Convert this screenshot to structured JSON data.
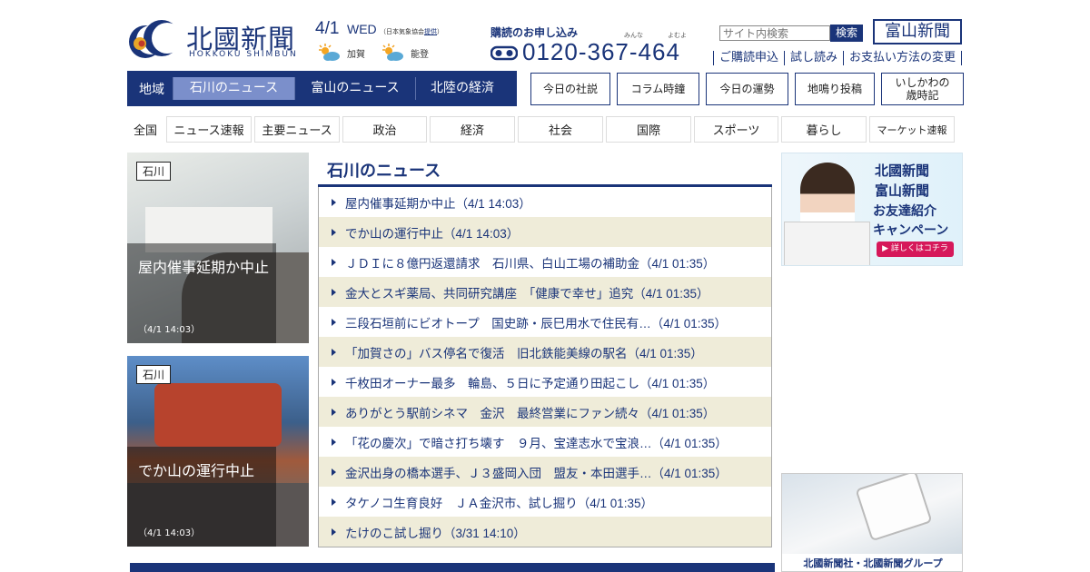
{
  "header": {
    "logo_text": "北國新聞",
    "logo_sub": "HOKKOKU SHIMBUN",
    "date": "4/1",
    "weekday": "WED",
    "weather_note_prefix": "（日本気象協会",
    "weather_note_link": "提供",
    "weather_note_suffix": "）",
    "weather": [
      {
        "area": "加賀",
        "icon": "sun-cloud-icon"
      },
      {
        "area": "能登",
        "icon": "sun-cloud-icon"
      }
    ],
    "subscribe_title": "購読のお申し込み",
    "ruby_1": "みんな",
    "ruby_2": "よむよ",
    "tel": "0120-367-464",
    "search_placeholder": "サイト内検索",
    "search_button": "検索",
    "toyama_button": "富山新聞",
    "links": [
      "ご購読申込",
      "試し読み",
      "お支払い方法の変更"
    ]
  },
  "region_nav": {
    "label": "地域",
    "items": [
      {
        "label": "石川のニュース",
        "active": true
      },
      {
        "label": "富山のニュース",
        "active": false
      },
      {
        "label": "北陸の経済",
        "active": false
      }
    ]
  },
  "column_nav": [
    "今日の社説",
    "コラム時鐘",
    "今日の運勢",
    "地鳴り投稿",
    "いしかわの",
    "歳時記"
  ],
  "category_nav": {
    "first": "全国",
    "items": [
      "ニュース速報",
      "主要ニュース",
      "政治",
      "経済",
      "社会",
      "国際",
      "スポーツ",
      "暮らし",
      "マーケット速報"
    ]
  },
  "cards": [
    {
      "tag": "石川",
      "caption": "屋内催事延期か中止",
      "time": "（4/1 14:03）"
    },
    {
      "tag": "石川",
      "caption": "でか山の運行中止",
      "time": "（4/1 14:03）"
    }
  ],
  "news": {
    "title": "石川のニュース",
    "items": [
      "屋内催事延期か中止（4/1 14:03）",
      "でか山の運行中止（4/1 14:03）",
      "ＪＤＩに８億円返還請求　石川県、白山工場の補助金（4/1 01:35）",
      "金大とスギ薬局、共同研究講座　「健康で幸せ」追究（4/1 01:35）",
      "三段石垣前にビオトープ　国史跡・辰巳用水で住民有…（4/1 01:35）",
      "「加賀さの」バス停名で復活　旧北鉄能美線の駅名（4/1 01:35）",
      "千枚田オーナー最多　輪島、５日に予定通り田起こし（4/1 01:35）",
      "ありがとう駅前シネマ　金沢　最終営業にファン続々（4/1 01:35）",
      "「花の慶次」で暗さ打ち壊す　９月、宝達志水で宝浪…（4/1 01:35）",
      "金沢出身の橋本選手、Ｊ３盛岡入団　盟友・本田選手…（4/1 01:35）",
      "タケノコ生育良好　ＪＡ金沢市、試し掘り（4/1 01:35）",
      "たけのこ試し掘り（3/31 14:10）"
    ]
  },
  "ads": {
    "campaign_line1": "北國新聞",
    "campaign_line2": "富山新聞",
    "campaign_line3": "お友達紹介",
    "campaign_line4": "キャンペーン",
    "campaign_pill": "▶ 詳しくはコチラ",
    "group_footer": "北國新聞社・北國新聞グループ"
  },
  "colors": {
    "brand": "#1a3479",
    "stripe": "#efecd9",
    "active_tab": "#7b8fcb"
  }
}
